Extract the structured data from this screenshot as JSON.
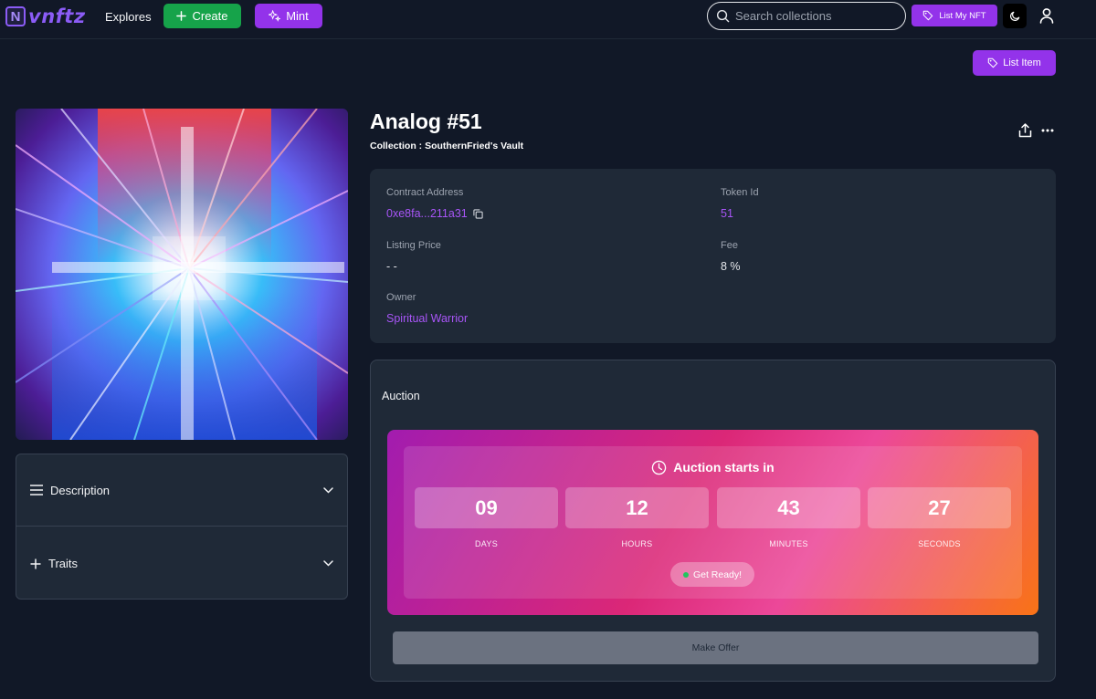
{
  "nav": {
    "logo_text": "vnftz",
    "logo_letter": "N",
    "explores": "Explores",
    "create": "Create",
    "mint": "Mint",
    "search_placeholder": "Search collections",
    "list_my_nft": "List My NFT"
  },
  "actions": {
    "list_item": "List Item"
  },
  "nft": {
    "title": "Analog #51",
    "collection": "Collection : SouthernFried's Vault"
  },
  "info": {
    "contract_label": "Contract Address",
    "contract_value": "0xe8fa...211a31",
    "token_label": "Token Id",
    "token_value": "51",
    "price_label": "Listing Price",
    "price_value": "- -",
    "fee_label": "Fee",
    "fee_value": "8 %",
    "owner_label": "Owner",
    "owner_value": "Spiritual Warrior"
  },
  "accordion": {
    "description": "Description",
    "traits": "Traits"
  },
  "auction": {
    "title": "Auction",
    "starts_in": "Auction starts in",
    "days": "09",
    "hours": "12",
    "minutes": "43",
    "seconds": "27",
    "days_label": "DAYS",
    "hours_label": "HOURS",
    "minutes_label": "MINUTES",
    "seconds_label": "SECONDS",
    "get_ready": "Get Ready!",
    "make_offer": "Make Offer"
  },
  "colors": {
    "background": "#111827",
    "card": "#1f2937",
    "accent_purple": "#9333ea",
    "create_green": "#16a34a",
    "link_purple": "#a855f7"
  }
}
